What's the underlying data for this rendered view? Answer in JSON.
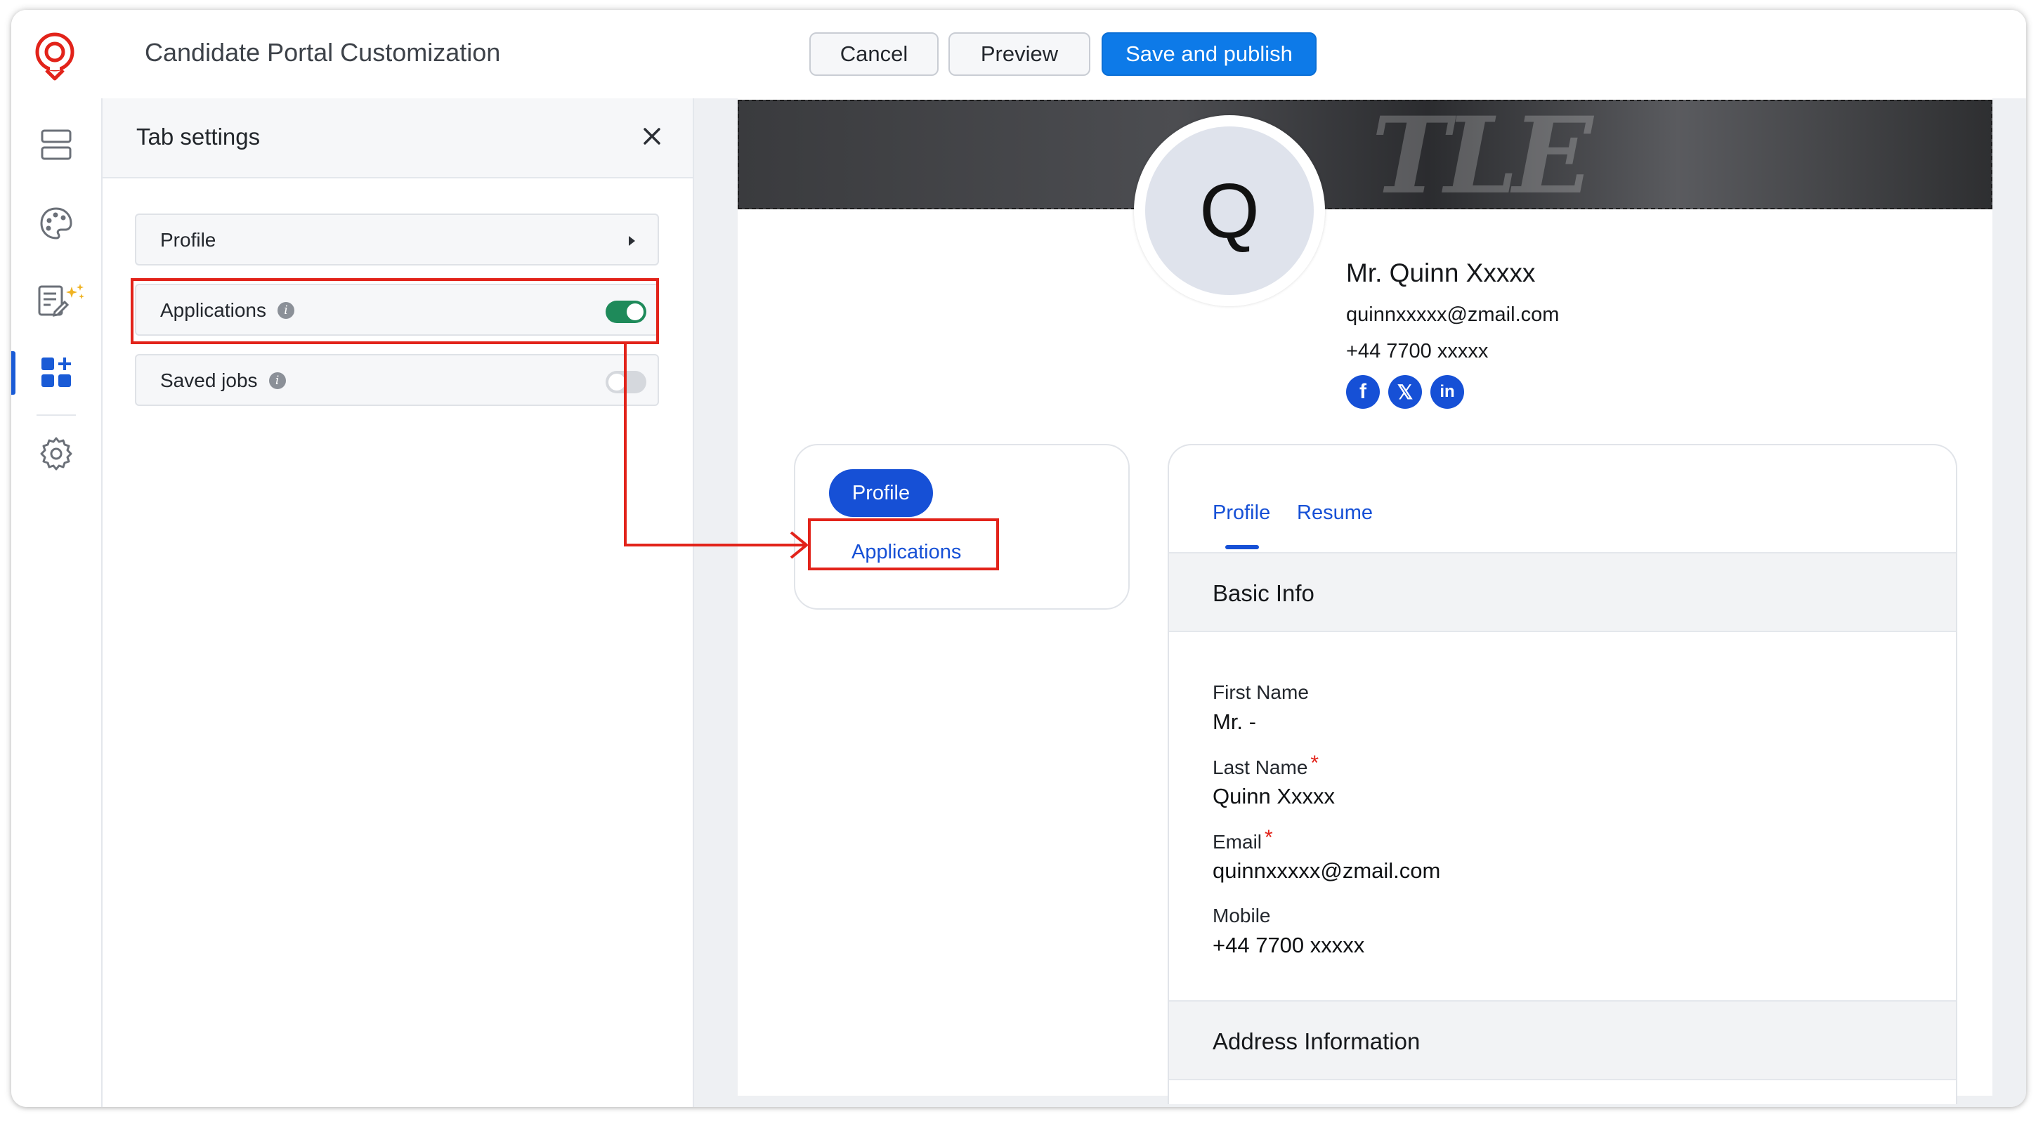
{
  "header": {
    "title": "Candidate Portal Customization",
    "cancel_label": "Cancel",
    "preview_label": "Preview",
    "publish_label": "Save and publish"
  },
  "rail": {
    "icons": [
      "layout-sections-icon",
      "palette-icon",
      "form-ai-icon",
      "apps-grid-icon",
      "settings-gear-icon"
    ],
    "active_index": 3
  },
  "tab_settings": {
    "title": "Tab settings",
    "rows": [
      {
        "label": "Profile",
        "control": "submenu-caret"
      },
      {
        "label": "Applications",
        "control": "toggle",
        "enabled": true
      },
      {
        "label": "Saved jobs",
        "control": "toggle",
        "enabled": false
      }
    ]
  },
  "preview": {
    "avatar_letter": "Q",
    "name": "Mr. Quinn Xxxxx",
    "email": "quinnxxxxx@zmail.com",
    "phone": "+44 7700 xxxxx",
    "social": [
      "facebook-icon",
      "x-icon",
      "linkedin-icon"
    ],
    "nav": {
      "profile": "Profile",
      "applications": "Applications"
    },
    "tabs": {
      "profile": "Profile",
      "resume": "Resume"
    },
    "basic_info_title": "Basic Info",
    "fields": {
      "first_name_label": "First Name",
      "first_name_value": "Mr. -",
      "last_name_label": "Last Name",
      "last_name_value": "Quinn Xxxxx",
      "email_label": "Email",
      "email_value": "quinnxxxxx@zmail.com",
      "mobile_label": "Mobile",
      "mobile_value": "+44 7700 xxxxx",
      "required_mark": "*"
    },
    "address_title": "Address Information"
  },
  "colors": {
    "primary": "#0d7ae8",
    "link": "#1650d6",
    "toggle_on": "#1e8a5a",
    "toggle_off": "#d5d8dd",
    "annotation": "#e2231a"
  }
}
